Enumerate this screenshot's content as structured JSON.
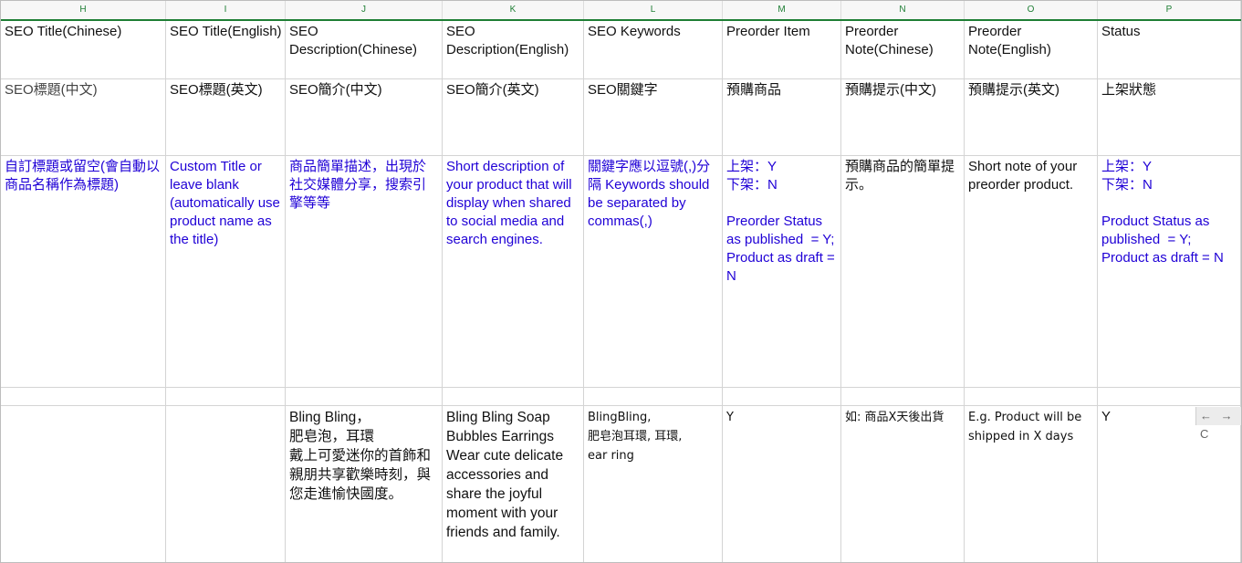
{
  "columns": [
    "H",
    "I",
    "J",
    "K",
    "L",
    "M",
    "N",
    "O",
    "P"
  ],
  "rows": [
    {
      "row_name": "header",
      "cells": [
        {
          "text": "SEO Title(Chinese)"
        },
        {
          "text": "SEO Title(English)"
        },
        {
          "text": "SEO Description(Chinese)"
        },
        {
          "text": "SEO Description(English)"
        },
        {
          "text": "SEO Keywords"
        },
        {
          "text": "Preorder Item"
        },
        {
          "text": "Preorder Note(Chinese)"
        },
        {
          "text": "Preorder Note(English)"
        },
        {
          "text": "Status"
        }
      ]
    },
    {
      "row_name": "chinese-label",
      "cells": [
        {
          "text": "SEO標題(中文)"
        },
        {
          "text": "SEO標題(英文)"
        },
        {
          "text": "SEO簡介(中文)"
        },
        {
          "text": "SEO簡介(英文)"
        },
        {
          "text": "SEO關鍵字"
        },
        {
          "text": "預購商品"
        },
        {
          "text": "預購提示(中文)"
        },
        {
          "text": "預購提示(英文)"
        },
        {
          "text": "上架狀態"
        }
      ]
    },
    {
      "row_name": "instructions",
      "cells": [
        {
          "text": "自訂標題或留空(會自動以商品名稱作為標題)"
        },
        {
          "text": "Custom Title or leave blank (automatically use product name as the title)"
        },
        {
          "text": "商品簡單描述，出現於社交媒體分享，搜索引擎等等"
        },
        {
          "text": "Short description of your product that will display when shared to social media and search engines."
        },
        {
          "text": "關鍵字應以逗號(,)分隔  Keywords should be separated by commas(,)"
        },
        {
          "text": "上架：Y\n下架：N\n\nPreorder Status as published  = Y; Product as draft = N"
        },
        {
          "text": "預購商品的簡單提示。"
        },
        {
          "text": "Short note of your preorder product."
        },
        {
          "text": "上架：Y\n下架：N\n\nProduct Status as published  = Y; Product as draft = N"
        }
      ]
    },
    {
      "row_name": "blank",
      "cells": [
        {
          "text": ""
        },
        {
          "text": ""
        },
        {
          "text": ""
        },
        {
          "text": ""
        },
        {
          "text": ""
        },
        {
          "text": ""
        },
        {
          "text": ""
        },
        {
          "text": ""
        },
        {
          "text": ""
        }
      ]
    },
    {
      "row_name": "example",
      "cells": [
        {
          "text": ""
        },
        {
          "text": ""
        },
        {
          "text": "Bling Bling，\n肥皂泡，耳環\n戴上可愛迷你的首飾和親朋共享歡樂時刻，與您走進愉快國度。"
        },
        {
          "text": "Bling Bling Soap Bubbles Earrings\nWear cute delicate accessories and share the joyful moment with your friends and family."
        },
        {
          "text": "BlingBling,\n肥皂泡耳環, 耳環,\near ring"
        },
        {
          "text": "Y"
        },
        {
          "text": "如: 商品X天後出貨"
        },
        {
          "text": "E.g. Product will be shipped in X days"
        },
        {
          "text": "Y"
        }
      ]
    }
  ],
  "nav_glyphs": "← → C",
  "colors": {
    "header_accent": "#1e7e34",
    "instruction_text": "#1f00d6",
    "label_text": "#444444"
  }
}
